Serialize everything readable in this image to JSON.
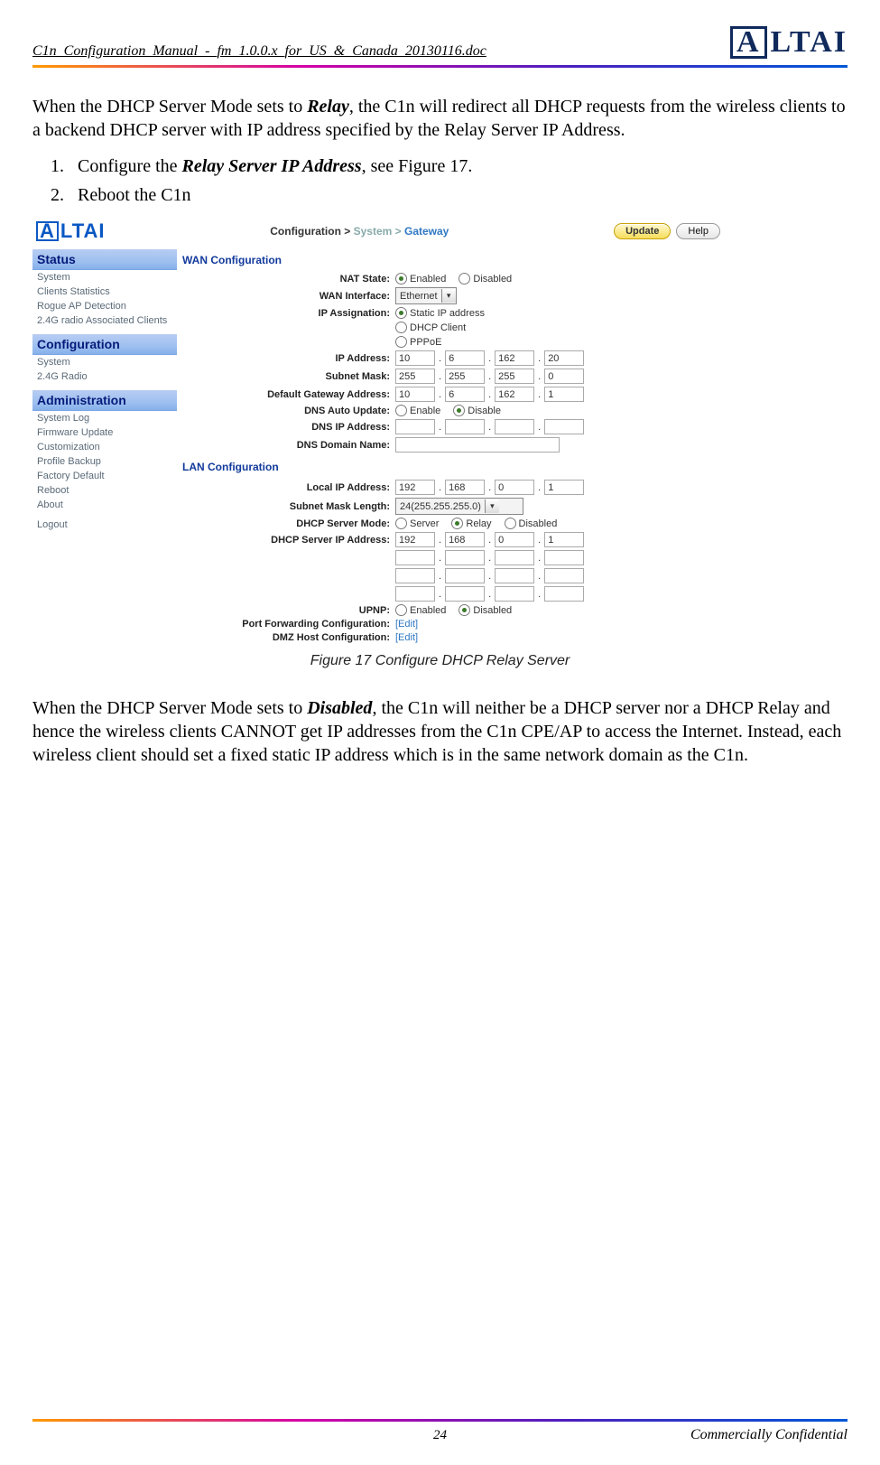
{
  "header": {
    "filename": "C1n_Configuration_Manual_-_fm_1.0.0.x_for_US_&_Canada_20130116.doc",
    "logo_main": "A L T A I",
    "logo_box": "A"
  },
  "paragraph1_pre": "When the DHCP Server Mode sets to ",
  "paragraph1_em": "Relay",
  "paragraph1_post": ", the C1n will redirect all DHCP requests from the wireless clients to a backend DHCP server with IP address specified by the Relay Server IP Address.",
  "steps": {
    "s1_pre": "Configure the ",
    "s1_em": "Relay Server IP Address",
    "s1_post": ", see Figure 17.",
    "s2": "Reboot the C1n"
  },
  "caption": "Figure 17    Configure DHCP Relay Server",
  "paragraph2_pre": "When the DHCP Server Mode sets to ",
  "paragraph2_em": "Disabled",
  "paragraph2_post": ", the C1n will neither be a DHCP server nor a DHCP Relay and hence the wireless clients CANNOT get IP addresses from the C1n CPE/AP to access the Internet. Instead, each wireless client should set a fixed static IP address which is in the same network domain as the C1n.",
  "footer": {
    "page": "24",
    "conf": "Commercially Confidential"
  },
  "shot": {
    "logo": "ALTAI",
    "crumb_pre": "Configuration >",
    "crumb_mid": "System",
    "crumb_gt": ">",
    "crumb_cur": "Gateway",
    "btn_update": "Update",
    "btn_help": "Help",
    "sidebar": {
      "status_head": "Status",
      "status_items": [
        "System",
        "Clients Statistics",
        "Rogue AP Detection",
        "2.4G radio Associated Clients"
      ],
      "config_head": "Configuration",
      "config_items": [
        "System",
        "2.4G Radio"
      ],
      "admin_head": "Administration",
      "admin_items": [
        "System Log",
        "Firmware Update",
        "Customization",
        "Profile Backup",
        "Factory Default",
        "Reboot",
        "About"
      ],
      "logout": "Logout"
    },
    "wan": {
      "section": "WAN Configuration",
      "nat_label": "NAT State:",
      "nat_enabled": "Enabled",
      "nat_disabled": "Disabled",
      "wan_if_label": "WAN Interface:",
      "wan_if_value": "Ethernet",
      "ip_assign_label": "IP Assignation:",
      "ip_assign_static": "Static IP address",
      "ip_assign_dhcp": "DHCP Client",
      "ip_assign_pppoe": "PPPoE",
      "ip_label": "IP Address:",
      "ip": [
        "10",
        "6",
        "162",
        "20"
      ],
      "mask_label": "Subnet Mask:",
      "mask": [
        "255",
        "255",
        "255",
        "0"
      ],
      "gw_label": "Default Gateway Address:",
      "gw": [
        "10",
        "6",
        "162",
        "1"
      ],
      "dns_auto_label": "DNS Auto Update:",
      "dns_auto_enable": "Enable",
      "dns_auto_disable": "Disable",
      "dns_ip_label": "DNS IP Address:",
      "dns_ip": [
        "",
        "",
        "",
        ""
      ],
      "dns_dn_label": "DNS Domain Name:"
    },
    "lan": {
      "section": "LAN Configuration",
      "lip_label": "Local IP Address:",
      "lip": [
        "192",
        "168",
        "0",
        "1"
      ],
      "mlen_label": "Subnet Mask Length:",
      "mlen_value": "24(255.255.255.0)",
      "mode_label": "DHCP Server Mode:",
      "mode_server": "Server",
      "mode_relay": "Relay",
      "mode_disabled": "Disabled",
      "sip_label": "DHCP Server IP Address:",
      "sip": [
        "192",
        "168",
        "0",
        "1"
      ],
      "upnp_label": "UPNP:",
      "upnp_en": "Enabled",
      "upnp_dis": "Disabled",
      "pf_label": "Port Forwarding Configuration:",
      "dmz_label": "DMZ Host Configuration:",
      "edit": "[Edit]"
    }
  }
}
